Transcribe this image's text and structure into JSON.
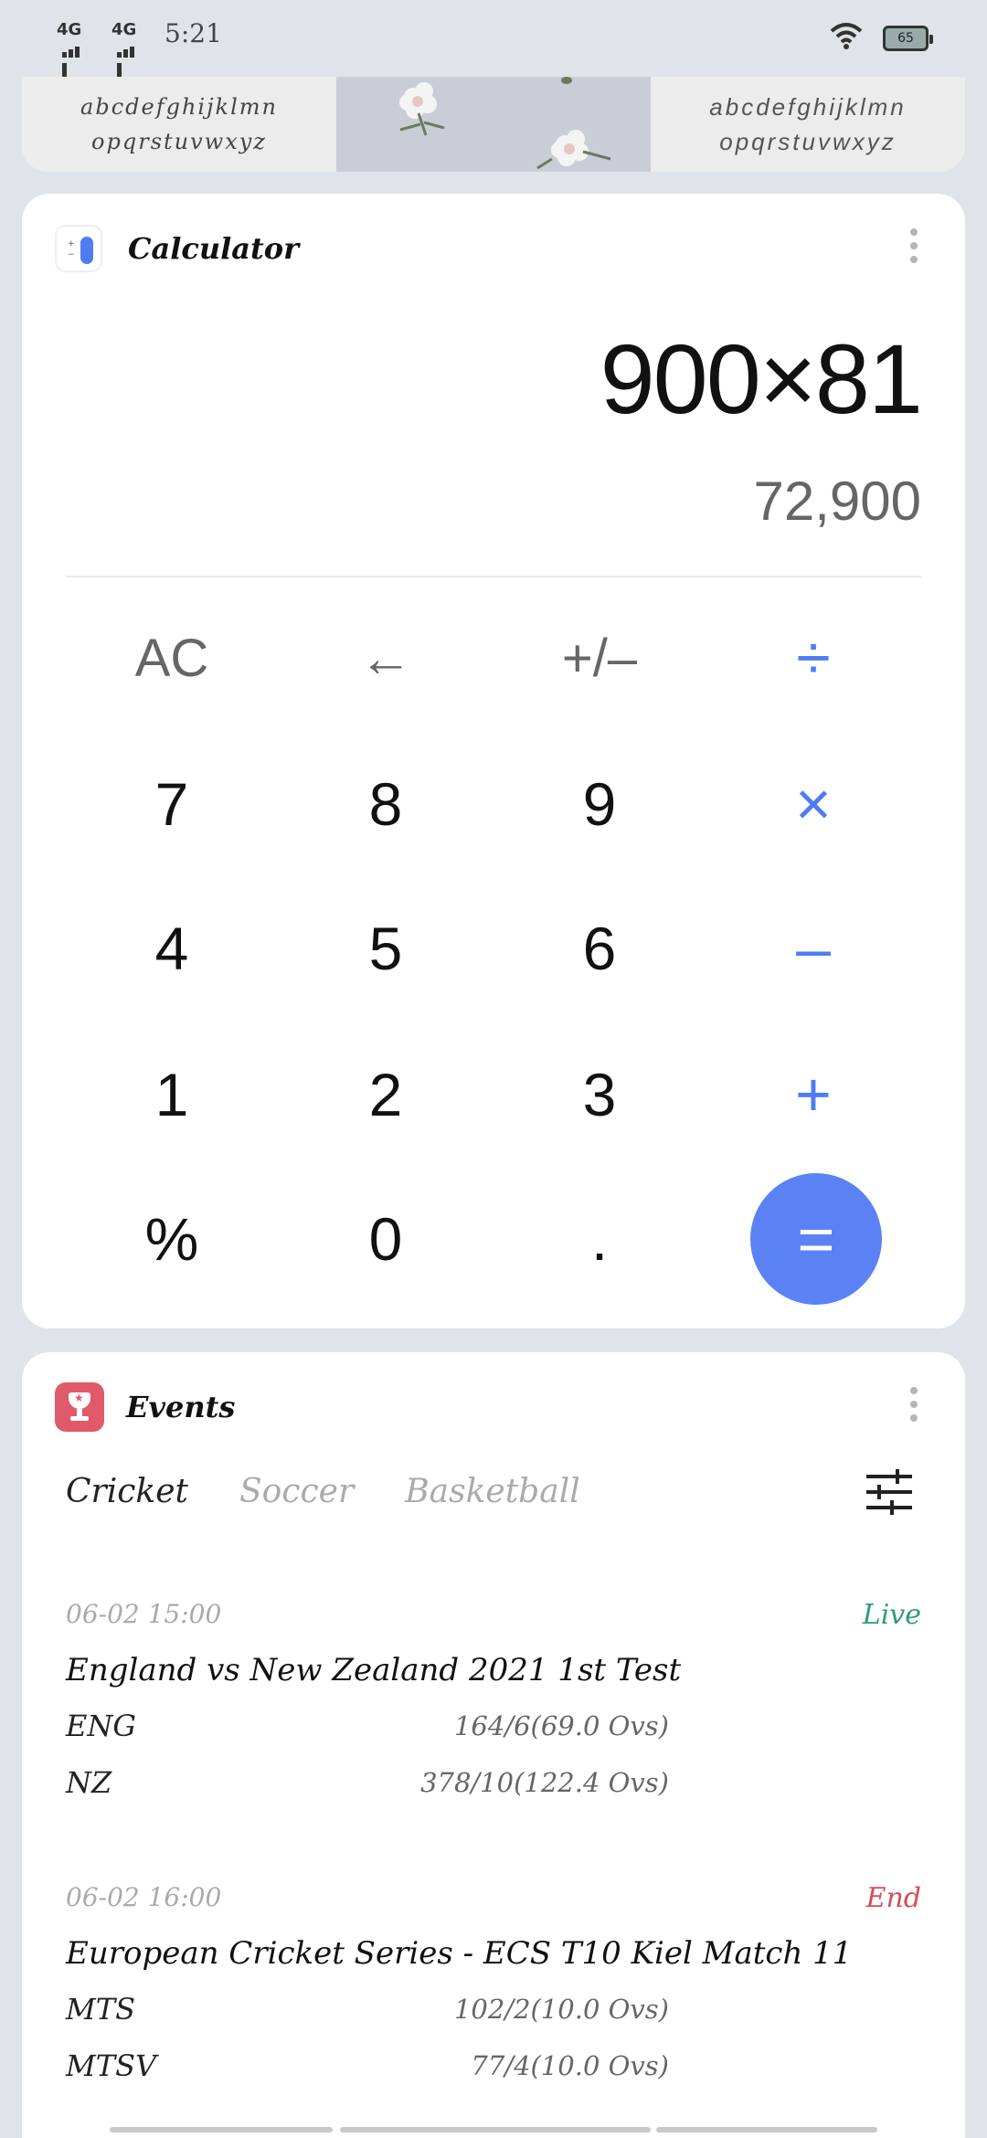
{
  "status_bar": {
    "signal_1": "4G",
    "signal_2": "4G",
    "time": "5:21",
    "battery": "65"
  },
  "font_preview": {
    "line1": "abcdefghijklmn",
    "line2": "opqrstuvwxyz"
  },
  "calculator": {
    "title": "Calculator",
    "expression": "900×81",
    "result": "72,900",
    "keys": {
      "ac": "AC",
      "backspace": "←",
      "sign": "+/–",
      "divide": "÷",
      "seven": "7",
      "eight": "8",
      "nine": "9",
      "multiply": "×",
      "four": "4",
      "five": "5",
      "six": "6",
      "minus": "–",
      "one": "1",
      "two": "2",
      "three": "3",
      "plus": "+",
      "percent": "%",
      "zero": "0",
      "dot": ".",
      "equals": "="
    },
    "accent_color": "#5b82f5"
  },
  "events": {
    "title": "Events",
    "tabs": [
      "Cricket",
      "Soccer",
      "Basketball"
    ],
    "active_tab": "Cricket",
    "matches": [
      {
        "time": "06-02 15:00",
        "status": "Live",
        "title": "England vs New Zealand 2021 1st Test",
        "team1": "ENG",
        "score1": "164/6(69.0 Ovs)",
        "team2": "NZ",
        "score2": "378/10(122.4 Ovs)"
      },
      {
        "time": "06-02 16:00",
        "status": "End",
        "title": "European Cricket Series - ECS T10 Kiel Match 11",
        "team1": "MTS",
        "score1": "102/2(10.0 Ovs)",
        "team2": "MTSV",
        "score2": "77/4(10.0 Ovs)"
      }
    ],
    "live_color": "#2d9b73",
    "end_color": "#d94b55"
  }
}
